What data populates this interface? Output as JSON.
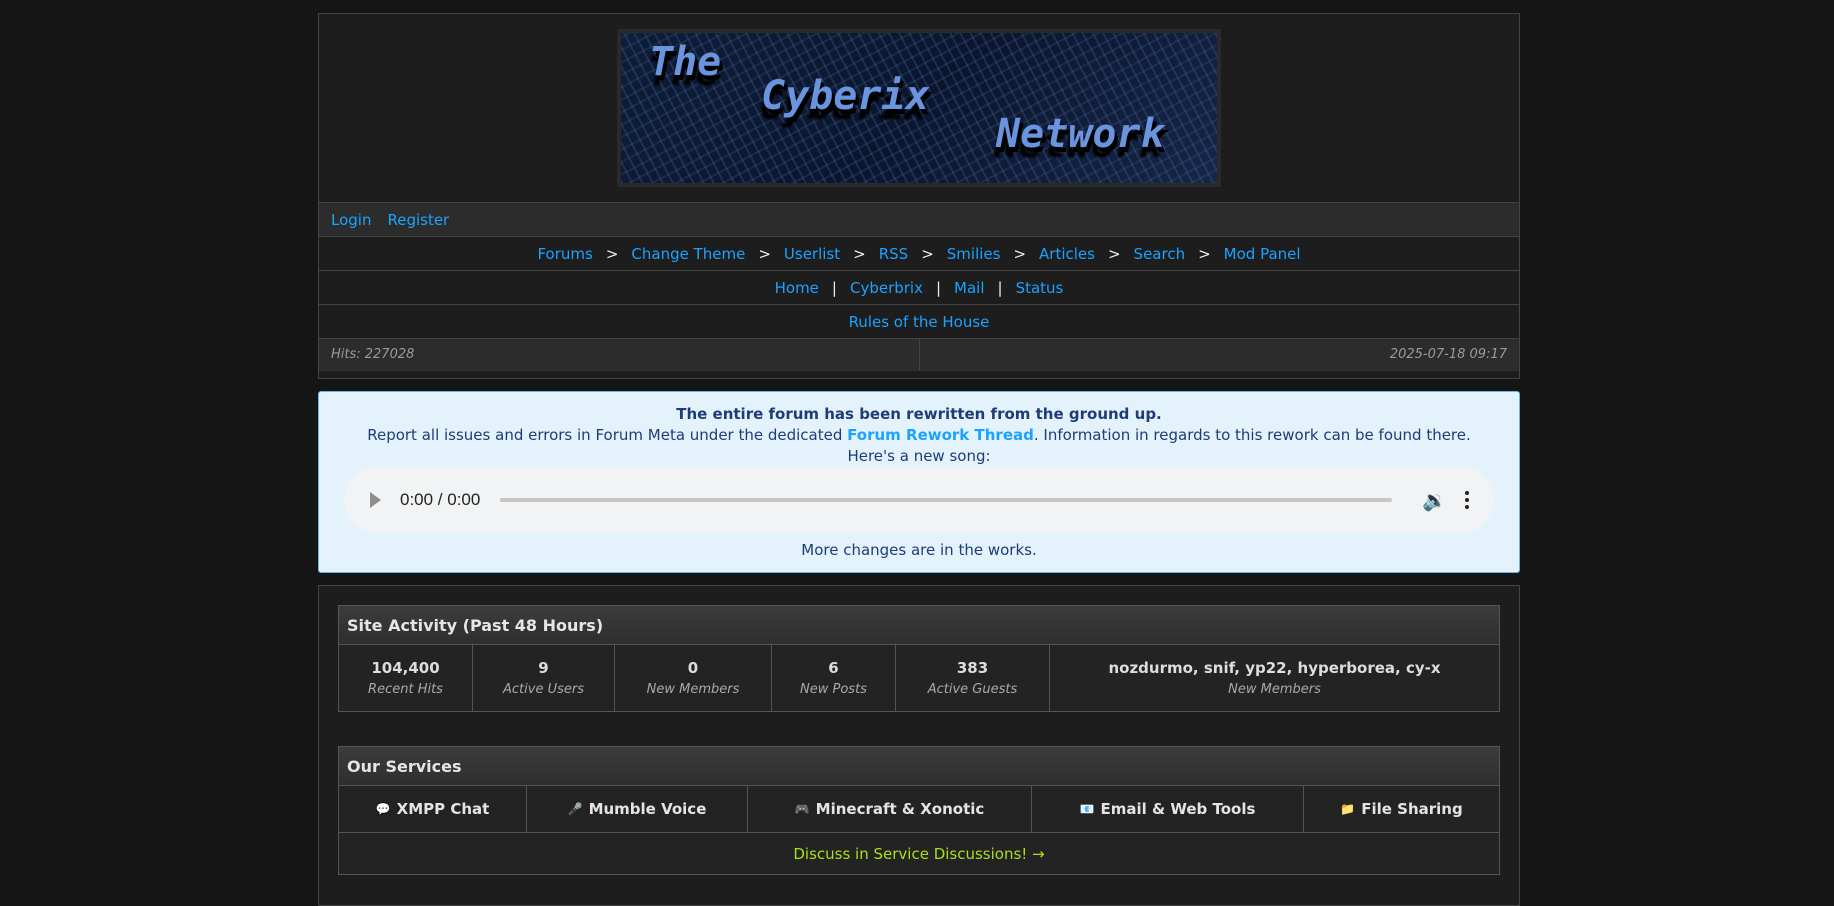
{
  "banner": {
    "line1": "The",
    "line2": "Cyberix",
    "line3": "Network"
  },
  "auth": {
    "login": "Login",
    "register": "Register"
  },
  "nav": {
    "main": [
      "Forums",
      "Change Theme",
      "Userlist",
      "RSS",
      "Smilies",
      "Articles",
      "Search",
      "Mod Panel"
    ],
    "main_sep": ">",
    "secondary": [
      "Home",
      "Cyberbrix",
      "Mail",
      "Status"
    ],
    "secondary_sep": "|",
    "rules": "Rules of the House"
  },
  "status_bar": {
    "hits": "Hits: 227028",
    "datetime": "2025-07-18 09:17"
  },
  "notice": {
    "headline": "The entire forum has been rewritten from the ground up.",
    "report_prefix": "Report all issues and errors in Forum Meta under the dedicated ",
    "report_link": "Forum Rework Thread",
    "report_suffix": ". Information in regards to this rework can be found there.",
    "song_intro": "Here's a new song:",
    "player_time": "0:00 / 0:00",
    "footer": "More changes are in the works."
  },
  "activity": {
    "title": "Site Activity (Past 48 Hours)",
    "stats": [
      {
        "value": "104,400",
        "label": "Recent Hits"
      },
      {
        "value": "9",
        "label": "Active Users"
      },
      {
        "value": "0",
        "label": "New Members"
      },
      {
        "value": "6",
        "label": "New Posts"
      },
      {
        "value": "383",
        "label": "Active Guests"
      },
      {
        "value": "nozdurmo, snif, yp22, hyperborea, cy-x",
        "label": "New Members"
      }
    ]
  },
  "services": {
    "title": "Our Services",
    "items": [
      {
        "icon": "speech-bubble-icon",
        "glyph": "💬",
        "label": "XMPP Chat"
      },
      {
        "icon": "microphone-icon",
        "glyph": "🎤",
        "label": "Mumble Voice"
      },
      {
        "icon": "gamepad-icon",
        "glyph": "🎮",
        "label": "Minecraft & Xonotic"
      },
      {
        "icon": "envelope-icon",
        "glyph": "📧",
        "label": "Email & Web Tools"
      },
      {
        "icon": "folder-icon",
        "glyph": "📁",
        "label": "File Sharing"
      }
    ],
    "discuss": "Discuss in Service Discussions! →"
  },
  "colors": {
    "link": "#1aa3ff",
    "notice_bg": "#e4f2fc",
    "discuss_link": "#a8e01a"
  }
}
